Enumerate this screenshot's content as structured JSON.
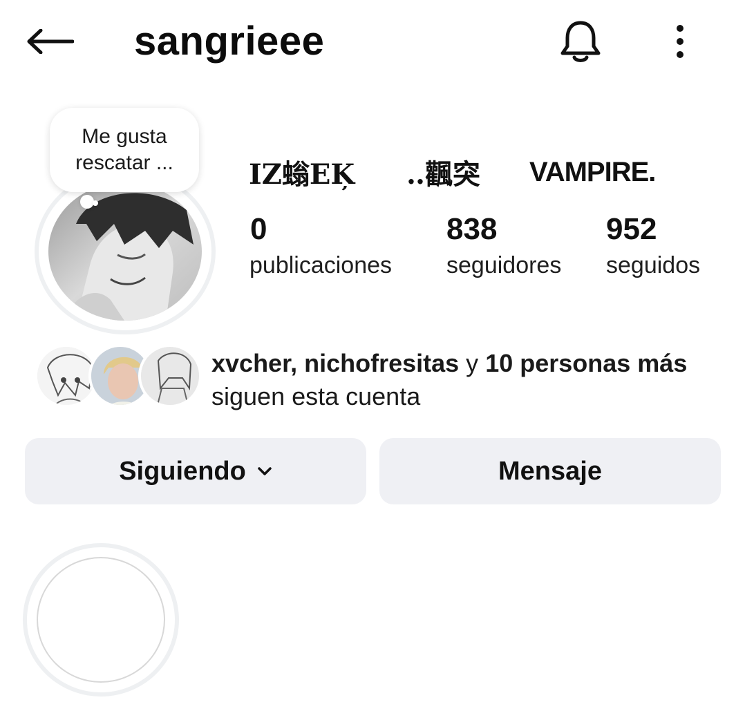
{
  "header": {
    "username": "sangrieee",
    "icons": {
      "back": "arrow-left-icon",
      "notifications": "bell-icon",
      "more": "vertical-dots-icon"
    }
  },
  "profile": {
    "note": "Me gusta rescatar ...",
    "stats": [
      {
        "decoration": "IZ螉EK̦",
        "count": "0",
        "label": "publicaciones"
      },
      {
        "decoration": "‥飌突",
        "count": "838",
        "label": "seguidores"
      },
      {
        "decoration": "VAMPIRE.",
        "count": "952",
        "label": "seguidos"
      }
    ]
  },
  "mutual": {
    "names": "xvcher, nichofresitas",
    "connector": " y ",
    "others_bold": "10 personas más",
    "suffix": " siguen esta cuenta"
  },
  "actions": {
    "following_label": "Siguiendo",
    "message_label": "Mensaje"
  }
}
